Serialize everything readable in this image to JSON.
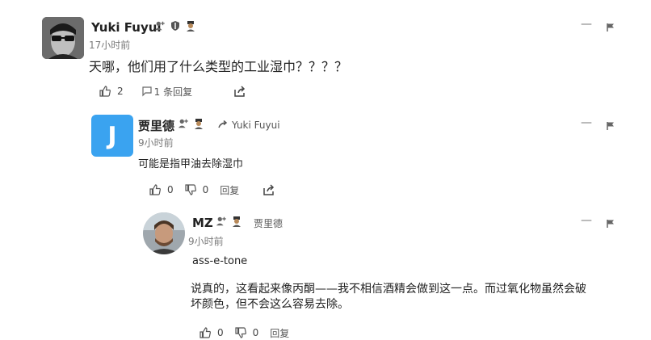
{
  "comments": [
    {
      "author": "Yuki Fuyui",
      "time": "17小时前",
      "text": "天哪，他们用了什么类型的工业湿巾？？？？",
      "likes": "2",
      "reply_count_label": "1 条回复"
    },
    {
      "author": "贾里德",
      "avatar_letter": "J",
      "avatar_color": "#3aa3f0",
      "reply_to": "Yuki Fuyui",
      "time": "9小时前",
      "text": "可能是指甲油去除湿巾",
      "likes": "0",
      "dislikes": "0",
      "reply_label": "回复"
    },
    {
      "author": "MZ",
      "reply_to": "贾里德",
      "time": "9小时前",
      "text1": "ass-e-tone",
      "text2": "说真的，这看起来像丙酮——我不相信酒精会做到这一点。而过氧化物虽然会破坏颜色，但不会这么容易去除。",
      "likes": "0",
      "dislikes": "0",
      "reply_label": "回复"
    }
  ]
}
